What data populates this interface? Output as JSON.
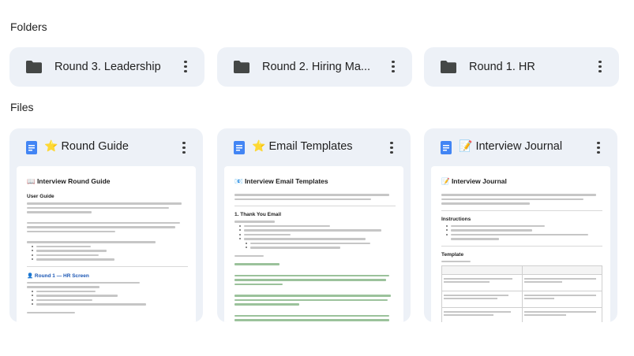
{
  "sections": {
    "folders_title": "Folders",
    "files_title": "Files"
  },
  "folders": [
    {
      "name": "Round 3. Leadership",
      "icon": "folder-icon"
    },
    {
      "name": "Round 2. Hiring Ma...",
      "icon": "folder-icon"
    },
    {
      "name": "Round 1. HR",
      "icon": "folder-icon"
    }
  ],
  "files": [
    {
      "emoji": "⭐",
      "name": "Round Guide",
      "icon": "google-docs-icon",
      "preview": {
        "title": "📖 Interview Round Guide",
        "h_user_guide": "User Guide",
        "h_round1": "👤 Round 1 — HR Screen"
      }
    },
    {
      "emoji": "⭐",
      "name": "Email Templates",
      "icon": "google-docs-icon",
      "preview": {
        "title": "📧 Interview Email Templates",
        "h_thank_you": "1. Thank You Email"
      }
    },
    {
      "emoji": "📝",
      "name": "Interview Journal",
      "icon": "google-docs-icon",
      "preview": {
        "title": "📝 Interview Journal",
        "h_instructions": "Instructions",
        "h_template": "Template"
      }
    }
  ],
  "colors": {
    "card_bg": "#edf1f7",
    "docs_blue": "#4285f4",
    "folder_gray": "#444746",
    "star": "#f4b400"
  }
}
